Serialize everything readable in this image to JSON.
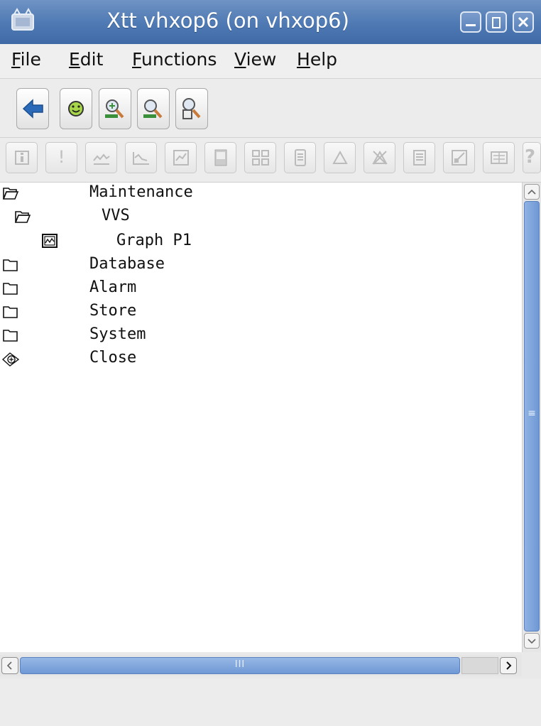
{
  "window": {
    "title": "Xtt vhxop6 (on vhxop6)"
  },
  "menubar": {
    "items": [
      {
        "mnemonic": "F",
        "rest": "ile"
      },
      {
        "mnemonic": "E",
        "rest": "dit"
      },
      {
        "mnemonic": "F",
        "rest": "unctions"
      },
      {
        "mnemonic": "V",
        "rest": "iew"
      },
      {
        "mnemonic": "H",
        "rest": "elp"
      }
    ]
  },
  "toolbar": {
    "icons": [
      "back-arrow-icon",
      "smiley-icon",
      "zoom-in-icon",
      "zoom-reset-icon",
      "zoom-object-icon"
    ]
  },
  "toolbar2": {
    "icons": [
      "info-icon",
      "exclamation-icon",
      "trend-icon",
      "fast-curve-icon",
      "graph-icon",
      "object-graph-icon",
      "crossref-icon",
      "help-class-icon",
      "alarm-icon",
      "blocked-icon",
      "list-icon",
      "plot-icon",
      "open-object-icon",
      "help-icon"
    ],
    "question_glyph": "?",
    "exclamation_glyph": "!"
  },
  "tree": {
    "items": [
      {
        "label": "Maintenance",
        "icon": "open-folder-icon"
      },
      {
        "label": "VVS",
        "icon": "open-folder-icon"
      },
      {
        "label": "Graph P1",
        "icon": "graph-icon"
      },
      {
        "label": "Database",
        "icon": "closed-folder-icon"
      },
      {
        "label": "Alarm",
        "icon": "closed-folder-icon"
      },
      {
        "label": "Store",
        "icon": "closed-folder-icon"
      },
      {
        "label": "System",
        "icon": "closed-folder-icon"
      },
      {
        "label": "Close",
        "icon": "close-leaf-icon"
      }
    ]
  },
  "scrollbars": {
    "vertical_grip": "≡",
    "horizontal_grip": "III"
  },
  "colors": {
    "titlebar": "#4e79b3",
    "scroll_thumb": "#6f98d4",
    "back_arrow": "#2a6ab8",
    "smiley": "#9acd32"
  }
}
